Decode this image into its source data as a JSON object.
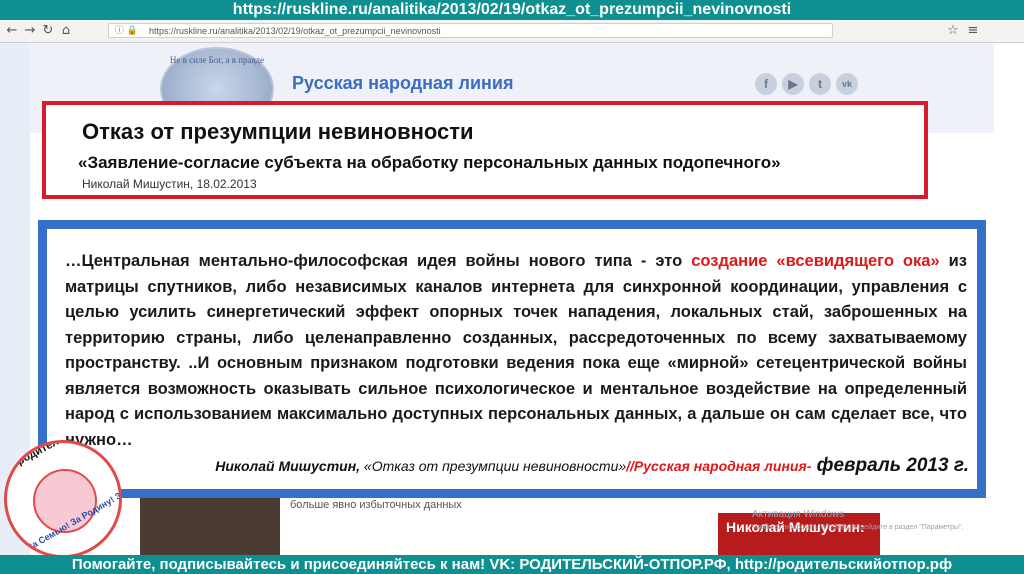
{
  "banner": {
    "url": "https://ruskline.ru/analitika/2013/02/19/otkaz_ot_prezumpcii_nevinovnosti"
  },
  "browser": {
    "address": "https://ruskline.ru/analitika/2013/02/19/otkaz_ot_prezumpcii_nevinovnosti",
    "back_icon": "back-arrow-icon",
    "forward_icon": "forward-arrow-icon",
    "reload_icon": "reload-icon",
    "home_icon": "home-icon"
  },
  "site": {
    "title": "Русская народная линия",
    "logo_motto": "Не в силе Бог, а в правде",
    "social": [
      "f",
      "▶",
      "t",
      "vk"
    ]
  },
  "card": {
    "title": "Отказ от презумпции невиновности",
    "subtitle": "«Заявление-согласие субъекта на обработку персональных данных подопечного»",
    "author": "Николай Мишустин, 18.02.2013"
  },
  "quote": {
    "p1": "…Центральная ментально-философская идея войны нового типа - это ",
    "p1_red": "создание «всевидящего ока»",
    "p2": " из матрицы спутников, либо независимых каналов интернета для синхронной координации, управления с целью усилить синергетический эффект опорных точек нападения, локальных стай, заброшенных на территорию страны, либо целенаправленно созданных, рассредоточенных по всему захватываемому пространству. ..И основным признаком подготовки ведения пока еще «мирной» сетецентрической войны является ",
    "p2_bold": "возможность оказывать сильное психологическое и ментальное воздействие на определенный народ",
    "p3": " с использованием максимально доступных персональных данных, а дальше он сам сделает все, что нужно…",
    "attrib_name": "Николай Мишустин,",
    "attrib_title": " «Отказ от презумпции невиновности»",
    "attrib_site": "//Русская народная линия-",
    "attrib_date": " февраль 2013 г."
  },
  "background": {
    "article_text": "предприняли эффективные действия по защите прав семьи от произвола административных учреждений. Но желание некоторых ретивых чинуш выслужиться перед сектантами «Электронной России» собрать как можно больше явно избыточных данных",
    "side_card": "Николай Мишустин:",
    "activation_title": "Активация Windows",
    "activation_hint": "Чтобы активировать Windows, перейдите в раздел \"Параметры\"."
  },
  "stamp": {
    "text1": "родительский-отпор.рф",
    "text2": "За Семью! За Родину! За Традиции!"
  },
  "footer": {
    "text": "Помогайте, подписывайтесь и присоединяйтесь к нам! VK: РОДИТЕЛЬСКИЙ-ОТПОР.РФ, http://родительскийотпор.рф"
  },
  "colors": {
    "banner": "#0f8f8f",
    "card_border": "#d51b2c",
    "quote_frame": "#3770c8",
    "highlight_red": "#e01818"
  }
}
